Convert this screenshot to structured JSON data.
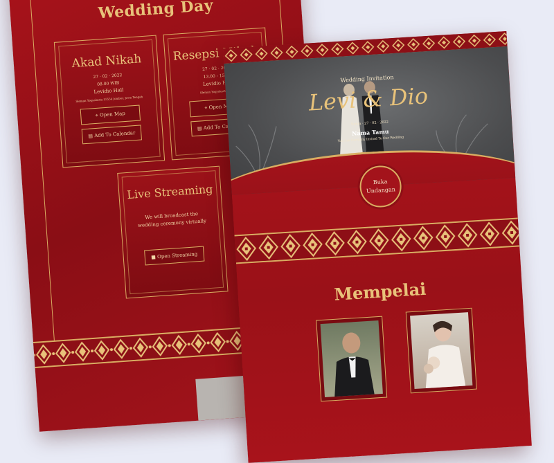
{
  "back_card": {
    "title": "Wedding Day",
    "akad": {
      "title": "Akad Nikah",
      "date": "27 · 02 · 2022",
      "time": "08.00 WIB",
      "venue": "Levidio Hall",
      "address": "Sleman Yogyakarta 55554 Jombor, Jawa Tengah",
      "map_label": "Open Map",
      "calendar_label": "Add To Calendar"
    },
    "resepsi": {
      "title": "Resepsi Nikah",
      "date": "27 · 02 · 2022",
      "time": "13.00 - 15.00",
      "venue": "Levidio Hall",
      "address": "Sleman Yogyakarta 55554",
      "map_label": "Open Map",
      "calendar_label": "Add To Calendar"
    },
    "streaming": {
      "title": "Live Streaming",
      "text": "We will broadcast the wedding ceremony virtually",
      "button_label": "Open Streaming"
    }
  },
  "front_card": {
    "invite_label": "Wedding Invitation",
    "names": "Levi & Dio",
    "date": "Senin · 27 · 02 · 2022",
    "guest_name": "Nama Tamu",
    "note": "You Are Cordially Invited To Our Wedding",
    "open_button": [
      "Buka",
      "Undangan"
    ],
    "section_title": "Mempelai"
  },
  "colors": {
    "primary_red": "#a3131b",
    "dark_red": "#8d0f16",
    "gold": "#e8c27a",
    "background": "#e9ebf6"
  }
}
